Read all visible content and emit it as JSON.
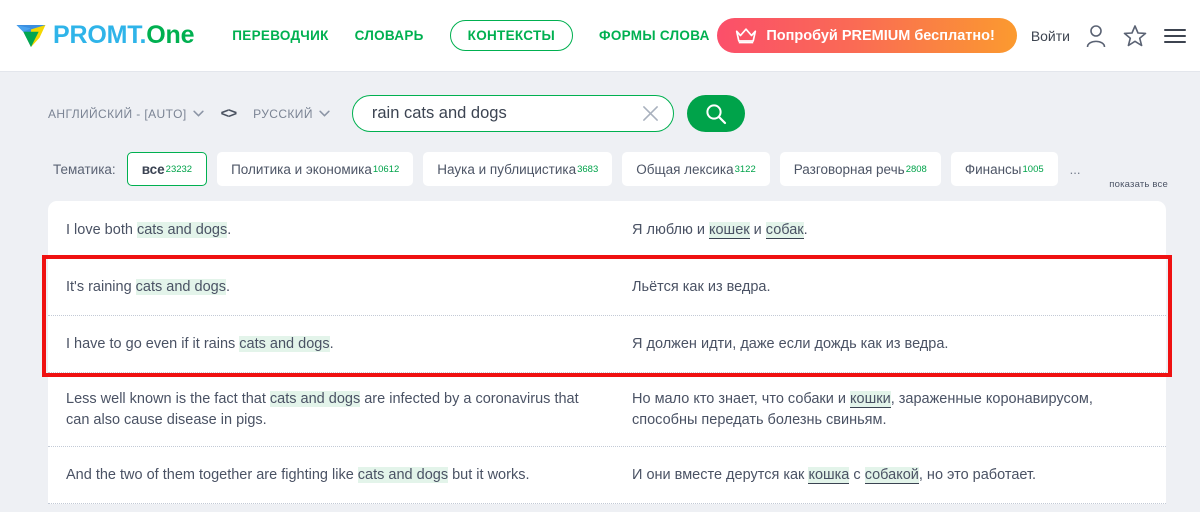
{
  "header": {
    "logo": {
      "promt": "PROMT",
      "dot": ".",
      "one": "One",
      "icon": "promt-logo-icon"
    },
    "nav": [
      {
        "label": "ПЕРЕВОДЧИК",
        "active": false
      },
      {
        "label": "СЛОВАРЬ",
        "active": false
      },
      {
        "label": "КОНТЕКСТЫ",
        "active": true
      },
      {
        "label": "ФОРМЫ СЛОВА",
        "active": false
      }
    ],
    "premium_button": {
      "label": "Попробуй PREMIUM бесплатно!",
      "icon": "crown-icon"
    },
    "login_label": "Войти",
    "icons": [
      "user-icon",
      "star-icon",
      "menu-icon"
    ],
    "accent_green": "#00b050",
    "logo_blue": "#2fb4e9"
  },
  "search": {
    "source_lang": "АНГЛИЙСКИЙ - [AUTO]",
    "swap_icon": "swap-languages-icon",
    "target_lang": "РУССКИЙ",
    "query": "rain cats and dogs",
    "placeholder": "rain cats and dogs",
    "clear_icon": "close-icon",
    "search_icon": "search-icon"
  },
  "topics": {
    "label": "Тематика:",
    "chips": [
      {
        "name": "все",
        "count": "23232",
        "active": true
      },
      {
        "name": "Политика и экономика",
        "count": "10612",
        "active": false
      },
      {
        "name": "Наука и публицистика",
        "count": "3683",
        "active": false
      },
      {
        "name": "Общая лексика",
        "count": "3122",
        "active": false
      },
      {
        "name": "Разговорная речь",
        "count": "2808",
        "active": false
      },
      {
        "name": "Финансы",
        "count": "1005",
        "active": false
      }
    ],
    "ellipsis": "...",
    "show_all": "показать все"
  },
  "results": {
    "highlight_color": "#ef1111",
    "rows": [
      {
        "source_parts": [
          {
            "t": "I love both ",
            "hl": false
          },
          {
            "t": "cats and dogs",
            "hl": true
          },
          {
            "t": ".",
            "hl": false
          }
        ],
        "target_parts": [
          {
            "t": "Я люблю и ",
            "hl": false
          },
          {
            "t": "кошек",
            "hl": true,
            "u": true
          },
          {
            "t": " и ",
            "hl": false
          },
          {
            "t": "собак",
            "hl": true,
            "u": true
          },
          {
            "t": ".",
            "hl": false
          }
        ],
        "marked": false
      },
      {
        "source_parts": [
          {
            "t": "It's raining ",
            "hl": false
          },
          {
            "t": "cats and dogs",
            "hl": true
          },
          {
            "t": ".",
            "hl": false
          }
        ],
        "target_parts": [
          {
            "t": "Льётся как из ведра.",
            "hl": false
          }
        ],
        "marked": true
      },
      {
        "source_parts": [
          {
            "t": "I have to go even if it rains ",
            "hl": false
          },
          {
            "t": "cats and dogs",
            "hl": true
          },
          {
            "t": ".",
            "hl": false
          }
        ],
        "target_parts": [
          {
            "t": "Я должен идти, даже если дождь как из ведра.",
            "hl": false
          }
        ],
        "marked": true
      },
      {
        "source_parts": [
          {
            "t": "Less well known is the fact that ",
            "hl": false
          },
          {
            "t": "cats and dogs",
            "hl": true
          },
          {
            "t": " are infected by a coronavirus that can also cause disease in pigs.",
            "hl": false
          }
        ],
        "target_parts": [
          {
            "t": "Но мало кто знает, что собаки и ",
            "hl": false
          },
          {
            "t": "кошки",
            "hl": true,
            "u": true
          },
          {
            "t": ", зараженные коронавирусом, способны передать болезнь свиньям.",
            "hl": false
          }
        ],
        "marked": false
      },
      {
        "source_parts": [
          {
            "t": "And the two of them together are fighting like ",
            "hl": false
          },
          {
            "t": "cats and dogs",
            "hl": true
          },
          {
            "t": " but it works.",
            "hl": false
          }
        ],
        "target_parts": [
          {
            "t": "И они вместе дерутся как ",
            "hl": false
          },
          {
            "t": "кошка",
            "hl": true,
            "u": true
          },
          {
            "t": " с ",
            "hl": false
          },
          {
            "t": "собакой",
            "hl": true,
            "u": true
          },
          {
            "t": ", но это работает.",
            "hl": false
          }
        ],
        "marked": false
      }
    ]
  }
}
